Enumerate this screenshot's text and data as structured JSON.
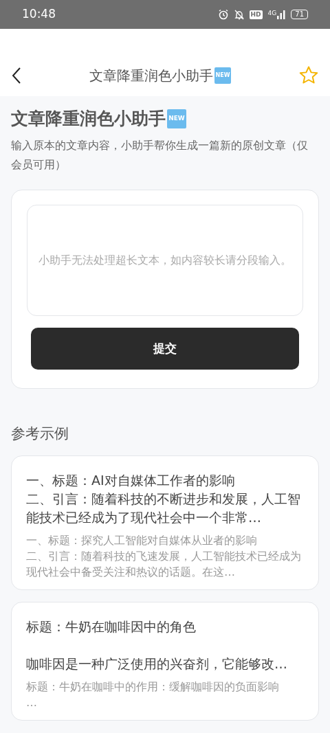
{
  "status_bar": {
    "time": "10:48",
    "hd": "HD",
    "network": "4G",
    "battery": "71"
  },
  "header": {
    "title": "文章降重润色小助手",
    "badge": "NEW",
    "favorited": false
  },
  "intro": {
    "title": "文章降重润色小助手",
    "badge": "NEW",
    "description": "输入原本的文章内容，小助手帮你生成一篇新的原创文章（仅会员可用）"
  },
  "form": {
    "placeholder": "小助手无法处理超长文本，如内容较长请分段输入。",
    "submit": "提交"
  },
  "examples_title": "参考示例",
  "examples": [
    {
      "input": [
        "一、标题：AI对自媒体工作者的影响",
        "二、引言：随着科技的不断进步和发展，人工智能技术已经成为了现代社会中一个非常…"
      ],
      "output": [
        "一、标题：探究人工智能对自媒体从业者的影响",
        "二、引言：随着科技的飞速发展，人工智能技术已经成为现代社会中备受关注和热议的话题。在这…"
      ]
    },
    {
      "input": [
        "标题：牛奶在咖啡因中的角色",
        "咖啡因是一种广泛使用的兴奋剂，它能够改…"
      ],
      "output": [
        "标题：牛奶在咖啡中的作用：缓解咖啡因的负面影响",
        "…"
      ]
    }
  ]
}
